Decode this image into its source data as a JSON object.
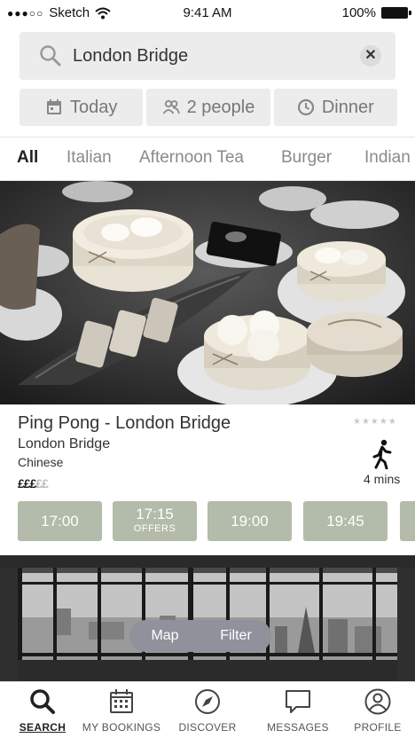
{
  "status_bar": {
    "carrier": "Sketch",
    "time": "9:41 AM",
    "battery": "100%"
  },
  "search": {
    "value": "London Bridge",
    "clear_icon": "close-icon"
  },
  "filters": [
    {
      "label": "Today",
      "icon": "calendar-icon"
    },
    {
      "label": "2 people",
      "icon": "people-icon"
    },
    {
      "label": "Dinner",
      "icon": "clock-icon"
    }
  ],
  "categories": [
    "All",
    "Italian",
    "Afternoon Tea",
    "Burger",
    "Indian"
  ],
  "active_category": "All",
  "restaurant": {
    "name": "Ping Pong - London Bridge",
    "area": "London Bridge",
    "cuisine": "Chinese",
    "price_filled": "£££",
    "price_empty": "££",
    "rating_stars": "★★★★★",
    "walk_time": "4 mins",
    "slots": [
      {
        "time": "17:00",
        "note": ""
      },
      {
        "time": "17:15",
        "note": "OFFERS"
      },
      {
        "time": "19:00",
        "note": ""
      },
      {
        "time": "19:45",
        "note": ""
      }
    ]
  },
  "floating": {
    "map_label": "Map",
    "filter_label": "Filter"
  },
  "bottom_nav": [
    {
      "label": "SEARCH",
      "icon": "search-icon",
      "active": true
    },
    {
      "label": "MY BOOKINGS",
      "icon": "calendar-icon",
      "active": false
    },
    {
      "label": "DISCOVER",
      "icon": "compass-icon",
      "active": false
    },
    {
      "label": "MESSAGES",
      "icon": "chat-icon",
      "active": false
    },
    {
      "label": "PROFILE",
      "icon": "user-icon",
      "active": false
    }
  ],
  "colors": {
    "slot_bg": "#b3bbaa",
    "floating_bg": "#8f929b"
  }
}
